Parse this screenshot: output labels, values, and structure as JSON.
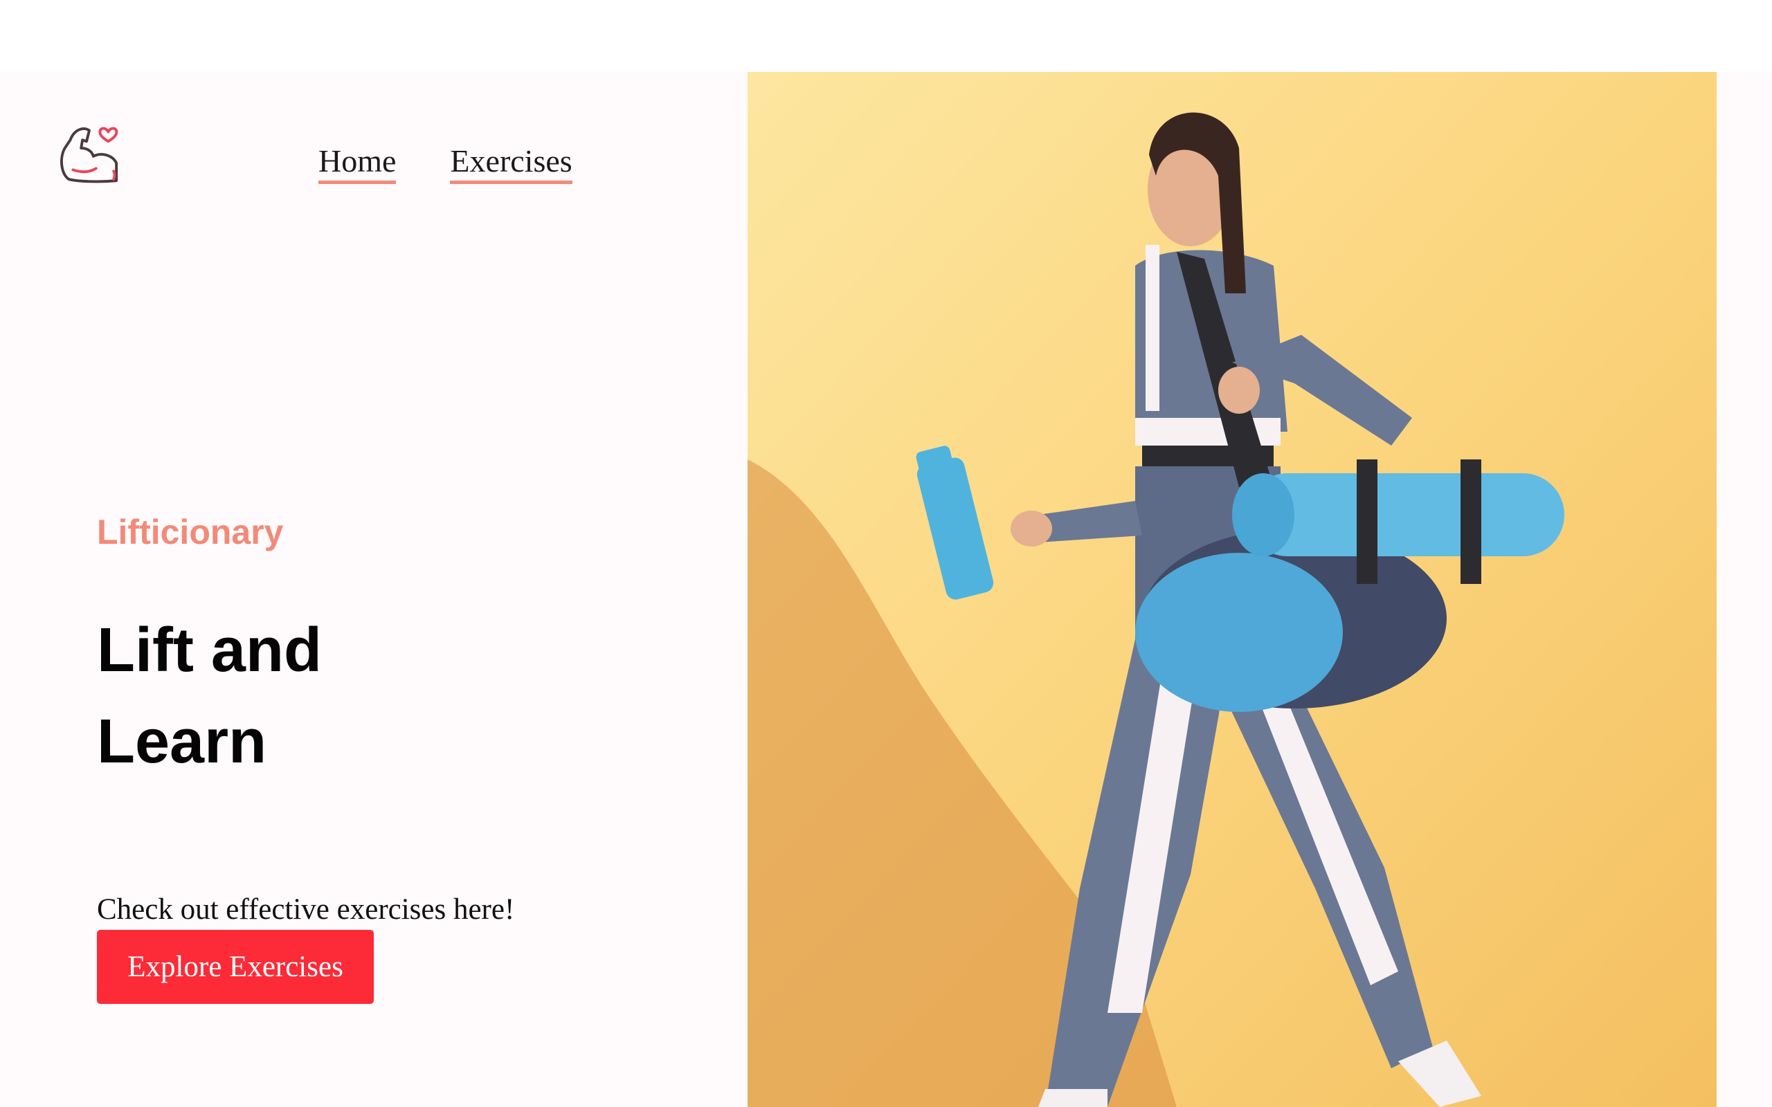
{
  "nav": {
    "items": [
      {
        "label": "Home"
      },
      {
        "label": "Exercises"
      }
    ]
  },
  "hero": {
    "eyebrow": "Lifticionary",
    "headline": "Lift and Learn",
    "subtext": "Check out effective exercises here!",
    "cta_label": "Explore Exercises"
  },
  "colors": {
    "accent": "#f28a79",
    "button": "#fd2a38",
    "page_background": "#fffafb",
    "photo_background": "#fbd57e"
  },
  "icons": {
    "logo": "flexed-arm-heart-icon"
  }
}
